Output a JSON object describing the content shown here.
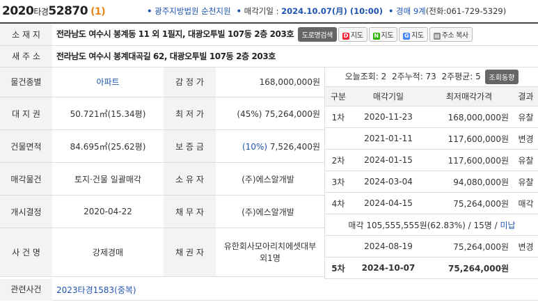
{
  "header": {
    "case_no": "2020",
    "case_type": "타경",
    "case_num": "52870",
    "seq": "(1)",
    "court": "광주지방법원 순천지원",
    "sale_date_label": "매각기일 : ",
    "sale_date": "2024.10.07(月) (10:00)",
    "dept_label": "경매 9계",
    "phone": "(전화:061-729-5329)"
  },
  "address": {
    "loc_label": "소 재 지",
    "loc_value": "전라남도 여수시 봉계동 11 외 1필지, 대광오투빌 107동 2층 203호",
    "btn_road": "도로명검색",
    "btn_daum": "지도",
    "btn_naver": "지도",
    "btn_google": "지도",
    "btn_copy": "주소 복사",
    "new_label": "새 주 소",
    "new_value": "전라남도 여수시 봉계대곡길 62, 대광오투빌 107동 2층 203호"
  },
  "details": [
    {
      "l1": "물건종별",
      "v1": "아파트",
      "l2": "감 정 가",
      "v2": "168,000,000원"
    },
    {
      "l1": "대 지 권",
      "v1": "50.721㎡(15.34평)",
      "l2": "최 저 가",
      "v2": "(45%) 75,264,000원"
    },
    {
      "l1": "건물면적",
      "v1": "84.695㎡(25.62평)",
      "l2": "보 증 금",
      "v2pct": "(10%)",
      "v2": "7,526,400원"
    },
    {
      "l1": "매각물건",
      "v1": "토지·건물 일괄매각",
      "l2": "소 유 자",
      "v2": "(주)에스알개발"
    },
    {
      "l1": "개시결정",
      "v1": "2020-04-22",
      "l2": "채 무 자",
      "v2": "(주)에스알개발"
    },
    {
      "l1": "사 건 명",
      "v1": "강제경매",
      "l2": "채 권 자",
      "v2": "유한회사모아리치에셋대부외1명"
    }
  ],
  "related": {
    "label": "관련사건",
    "value": "2023타경1583(중복)"
  },
  "stats": {
    "today": "오늘조회: 2",
    "total": "2주누적: 73",
    "avg": "2주평균: 5",
    "btn": "조회동향"
  },
  "history_headers": [
    "구분",
    "매각기일",
    "최저매각가격",
    "결과"
  ],
  "history": [
    {
      "round": "1차",
      "date": "2020-11-23",
      "price": "168,000,000원",
      "result": "유찰"
    },
    {
      "round": "",
      "date": "2021-01-11",
      "price": "117,600,000원",
      "result": "변경"
    },
    {
      "round": "2차",
      "date": "2024-01-15",
      "price": "117,600,000원",
      "result": "유찰"
    },
    {
      "round": "3차",
      "date": "2024-03-04",
      "price": "94,080,000원",
      "result": "유찰"
    },
    {
      "round": "4차",
      "date": "2024-04-15",
      "price": "75,264,000원",
      "result": "매각"
    }
  ],
  "sold_note": "매각 105,555,555원(62.83%) / 15명 / ",
  "sold_note_link": "미납",
  "history2": [
    {
      "round": "",
      "date": "2024-08-19",
      "price": "75,264,000원",
      "result": "변경"
    },
    {
      "round": "5차",
      "date": "2024-10-07",
      "price": "75,264,000원",
      "result": ""
    }
  ],
  "colors": {
    "accent_blue": "#1f55b0",
    "orange": "#e8831a"
  }
}
